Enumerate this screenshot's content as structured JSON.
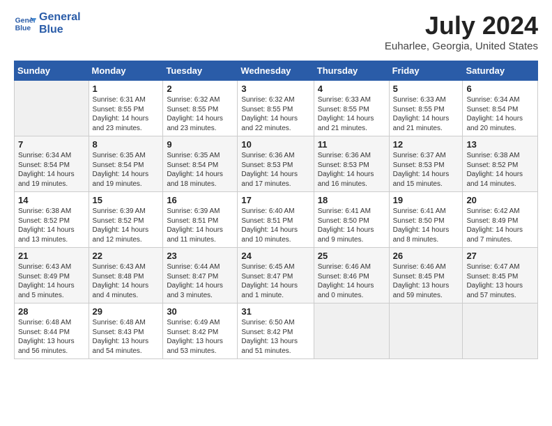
{
  "app": {
    "logo_line1": "General",
    "logo_line2": "Blue"
  },
  "calendar": {
    "month_year": "July 2024",
    "location": "Euharlee, Georgia, United States",
    "days_of_week": [
      "Sunday",
      "Monday",
      "Tuesday",
      "Wednesday",
      "Thursday",
      "Friday",
      "Saturday"
    ],
    "weeks": [
      [
        {
          "day": "",
          "content": ""
        },
        {
          "day": "1",
          "content": "Sunrise: 6:31 AM\nSunset: 8:55 PM\nDaylight: 14 hours\nand 23 minutes."
        },
        {
          "day": "2",
          "content": "Sunrise: 6:32 AM\nSunset: 8:55 PM\nDaylight: 14 hours\nand 23 minutes."
        },
        {
          "day": "3",
          "content": "Sunrise: 6:32 AM\nSunset: 8:55 PM\nDaylight: 14 hours\nand 22 minutes."
        },
        {
          "day": "4",
          "content": "Sunrise: 6:33 AM\nSunset: 8:55 PM\nDaylight: 14 hours\nand 21 minutes."
        },
        {
          "day": "5",
          "content": "Sunrise: 6:33 AM\nSunset: 8:55 PM\nDaylight: 14 hours\nand 21 minutes."
        },
        {
          "day": "6",
          "content": "Sunrise: 6:34 AM\nSunset: 8:54 PM\nDaylight: 14 hours\nand 20 minutes."
        }
      ],
      [
        {
          "day": "7",
          "content": "Sunrise: 6:34 AM\nSunset: 8:54 PM\nDaylight: 14 hours\nand 19 minutes."
        },
        {
          "day": "8",
          "content": "Sunrise: 6:35 AM\nSunset: 8:54 PM\nDaylight: 14 hours\nand 19 minutes."
        },
        {
          "day": "9",
          "content": "Sunrise: 6:35 AM\nSunset: 8:54 PM\nDaylight: 14 hours\nand 18 minutes."
        },
        {
          "day": "10",
          "content": "Sunrise: 6:36 AM\nSunset: 8:53 PM\nDaylight: 14 hours\nand 17 minutes."
        },
        {
          "day": "11",
          "content": "Sunrise: 6:36 AM\nSunset: 8:53 PM\nDaylight: 14 hours\nand 16 minutes."
        },
        {
          "day": "12",
          "content": "Sunrise: 6:37 AM\nSunset: 8:53 PM\nDaylight: 14 hours\nand 15 minutes."
        },
        {
          "day": "13",
          "content": "Sunrise: 6:38 AM\nSunset: 8:52 PM\nDaylight: 14 hours\nand 14 minutes."
        }
      ],
      [
        {
          "day": "14",
          "content": "Sunrise: 6:38 AM\nSunset: 8:52 PM\nDaylight: 14 hours\nand 13 minutes."
        },
        {
          "day": "15",
          "content": "Sunrise: 6:39 AM\nSunset: 8:52 PM\nDaylight: 14 hours\nand 12 minutes."
        },
        {
          "day": "16",
          "content": "Sunrise: 6:39 AM\nSunset: 8:51 PM\nDaylight: 14 hours\nand 11 minutes."
        },
        {
          "day": "17",
          "content": "Sunrise: 6:40 AM\nSunset: 8:51 PM\nDaylight: 14 hours\nand 10 minutes."
        },
        {
          "day": "18",
          "content": "Sunrise: 6:41 AM\nSunset: 8:50 PM\nDaylight: 14 hours\nand 9 minutes."
        },
        {
          "day": "19",
          "content": "Sunrise: 6:41 AM\nSunset: 8:50 PM\nDaylight: 14 hours\nand 8 minutes."
        },
        {
          "day": "20",
          "content": "Sunrise: 6:42 AM\nSunset: 8:49 PM\nDaylight: 14 hours\nand 7 minutes."
        }
      ],
      [
        {
          "day": "21",
          "content": "Sunrise: 6:43 AM\nSunset: 8:49 PM\nDaylight: 14 hours\nand 5 minutes."
        },
        {
          "day": "22",
          "content": "Sunrise: 6:43 AM\nSunset: 8:48 PM\nDaylight: 14 hours\nand 4 minutes."
        },
        {
          "day": "23",
          "content": "Sunrise: 6:44 AM\nSunset: 8:47 PM\nDaylight: 14 hours\nand 3 minutes."
        },
        {
          "day": "24",
          "content": "Sunrise: 6:45 AM\nSunset: 8:47 PM\nDaylight: 14 hours\nand 1 minute."
        },
        {
          "day": "25",
          "content": "Sunrise: 6:46 AM\nSunset: 8:46 PM\nDaylight: 14 hours\nand 0 minutes."
        },
        {
          "day": "26",
          "content": "Sunrise: 6:46 AM\nSunset: 8:45 PM\nDaylight: 13 hours\nand 59 minutes."
        },
        {
          "day": "27",
          "content": "Sunrise: 6:47 AM\nSunset: 8:45 PM\nDaylight: 13 hours\nand 57 minutes."
        }
      ],
      [
        {
          "day": "28",
          "content": "Sunrise: 6:48 AM\nSunset: 8:44 PM\nDaylight: 13 hours\nand 56 minutes."
        },
        {
          "day": "29",
          "content": "Sunrise: 6:48 AM\nSunset: 8:43 PM\nDaylight: 13 hours\nand 54 minutes."
        },
        {
          "day": "30",
          "content": "Sunrise: 6:49 AM\nSunset: 8:42 PM\nDaylight: 13 hours\nand 53 minutes."
        },
        {
          "day": "31",
          "content": "Sunrise: 6:50 AM\nSunset: 8:42 PM\nDaylight: 13 hours\nand 51 minutes."
        },
        {
          "day": "",
          "content": ""
        },
        {
          "day": "",
          "content": ""
        },
        {
          "day": "",
          "content": ""
        }
      ]
    ]
  }
}
